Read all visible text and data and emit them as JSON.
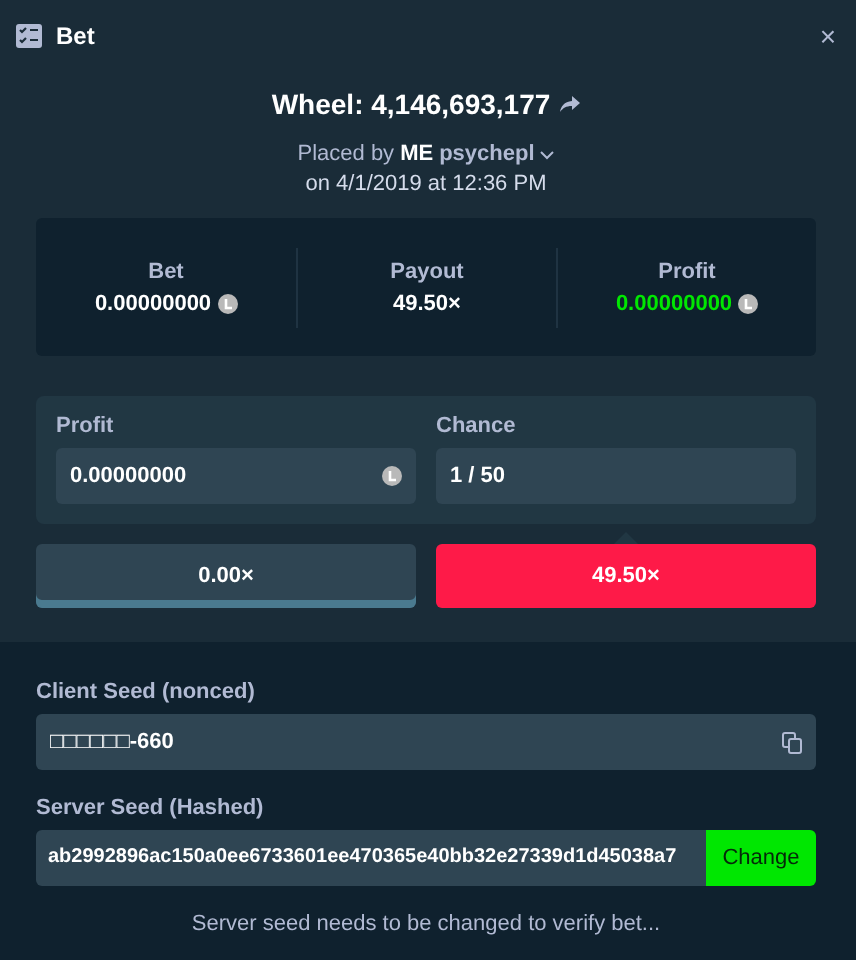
{
  "window": {
    "title": "Bet",
    "close": "×"
  },
  "game": {
    "title": "Wheel: 4,146,693,177",
    "placed_prefix": "Placed by",
    "user_badge": "ME",
    "user": "psychepl",
    "date": "on 4/1/2019 at 12:36 PM"
  },
  "stats": [
    {
      "label": "Bet",
      "value": "0.00000000",
      "coin": true,
      "positive": false
    },
    {
      "label": "Payout",
      "value": "49.50×",
      "coin": false,
      "positive": false
    },
    {
      "label": "Profit",
      "value": "0.00000000",
      "coin": true,
      "positive": true
    }
  ],
  "fields": [
    {
      "label": "Profit",
      "value": "0.00000000",
      "coin": true
    },
    {
      "label": "Chance",
      "value": "1 / 50",
      "coin": false
    }
  ],
  "segments": [
    {
      "label": "0.00×",
      "selected": false,
      "color": "#2f4553"
    },
    {
      "label": "49.50×",
      "selected": true,
      "color": "#fe1a48"
    }
  ],
  "client_seed": {
    "label": "Client Seed (nonced)",
    "value": "□□□□□□-660"
  },
  "server_seed": {
    "label": "Server Seed (Hashed)",
    "value": "ab2992896ac150a0ee6733601ee470365e40bb32e27339d1d45038a7",
    "button": "Change"
  },
  "notice": "Server seed needs to be changed to verify bet..."
}
